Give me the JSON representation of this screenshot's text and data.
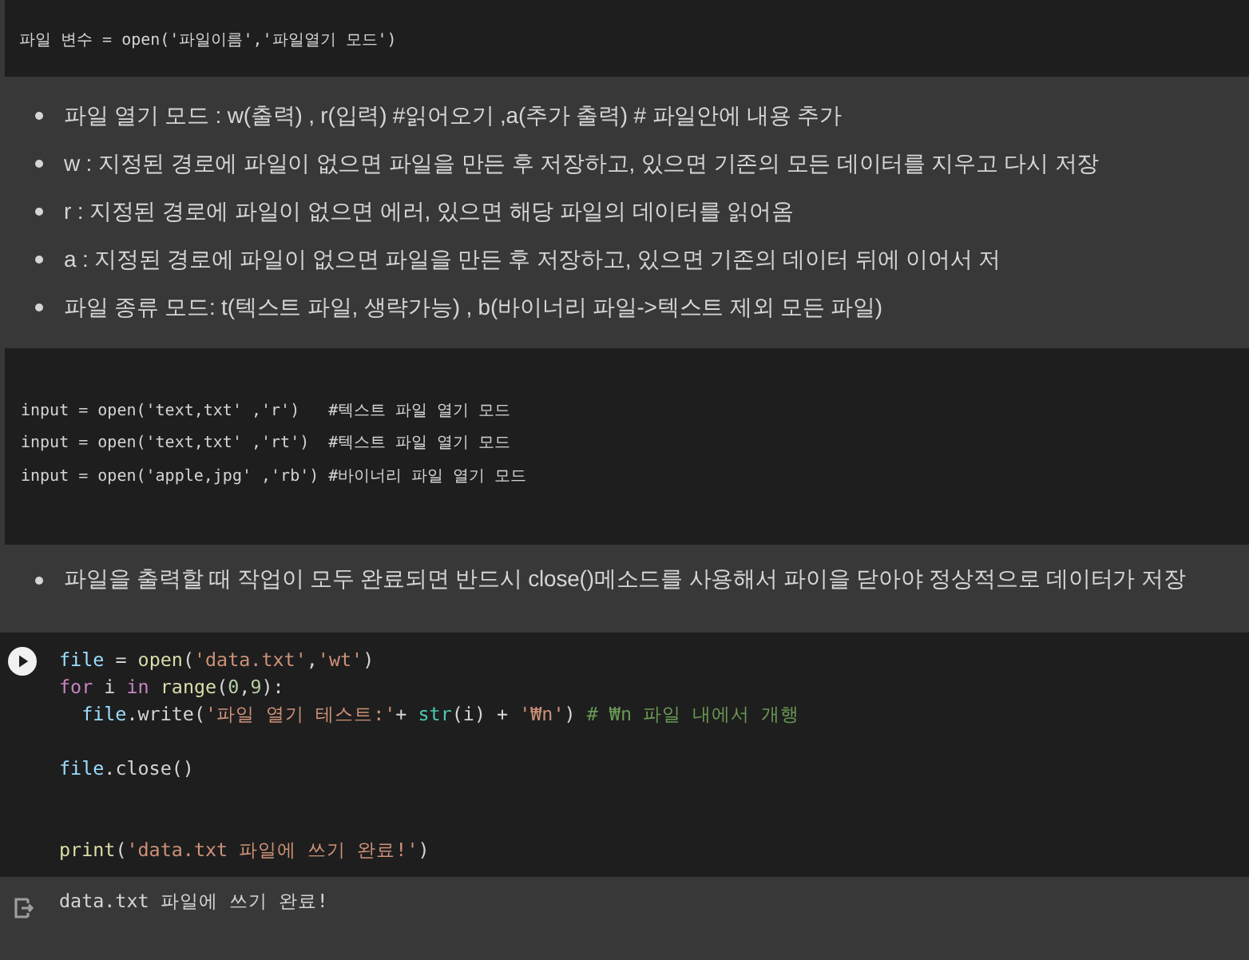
{
  "text_cell": {
    "blocks": [
      {
        "kind": "code_block",
        "lines": [
          "파일 변수 = open('파일이름','파일열기 모드')"
        ]
      },
      {
        "kind": "bullet_list",
        "items": [
          "파일 열기 모드 : w(출력) , r(입력) #읽어오기 ,a(추가 출력) # 파일안에 내용 추가",
          "w : 지정된 경로에 파일이 없으면 파일을 만든 후 저장하고, 있으면 기존의 모든 데이터를 지우고 다시 저장",
          "r : 지정된 경로에 파일이 없으면 에러, 있으면 해당 파일의 데이터를 읽어옴",
          "a : 지정된 경로에 파일이 없으면 파일을 만든 후 저장하고, 있으면 기존의 데이터 뒤에 이어서 저",
          "파일 종류 모드: t(텍스트 파일, 생략가능) , b(바이너리 파일->텍스트 제외 모든 파일)"
        ]
      },
      {
        "kind": "code_block",
        "lines": [
          "input = open('text,txt' ,'r')   #텍스트 파일 열기 모드",
          "input = open('text,txt' ,'rt')  #텍스트 파일 열기 모드",
          "input = open('apple,jpg' ,'rb') #바이너리 파일 열기 모드"
        ]
      },
      {
        "kind": "bullet_list",
        "items": [
          "파일을 출력할 때 작업이 모두 완료되면 반드시 close()메소드를 사용해서 파이을 닫아야 정상적으로 데이터가 저장"
        ]
      }
    ]
  },
  "code_cell": {
    "lines": [
      {
        "kind": "code",
        "tokens": [
          {
            "text": "file",
            "kind": "variable"
          },
          {
            "text": " = ",
            "kind": "plain"
          },
          {
            "text": "open",
            "kind": "function"
          },
          {
            "text": "(",
            "kind": "plain"
          },
          {
            "text": "'data.txt'",
            "kind": "string"
          },
          {
            "text": ",",
            "kind": "plain"
          },
          {
            "text": "'wt'",
            "kind": "string"
          },
          {
            "text": ")",
            "kind": "plain"
          }
        ]
      },
      {
        "kind": "code",
        "tokens": [
          {
            "text": "for",
            "kind": "keyword"
          },
          {
            "text": " i ",
            "kind": "plain"
          },
          {
            "text": "in",
            "kind": "keyword"
          },
          {
            "text": " range",
            "kind": "function"
          },
          {
            "text": "(",
            "kind": "plain"
          },
          {
            "text": "0",
            "kind": "number"
          },
          {
            "text": ",",
            "kind": "plain"
          },
          {
            "text": "9",
            "kind": "number"
          },
          {
            "text": "):",
            "kind": "plain"
          }
        ],
        "children": [
          {
            "kind": "code",
            "tokens": [
              {
                "text": "file",
                "kind": "variable"
              },
              {
                "text": ".write(",
                "kind": "plain"
              },
              {
                "text": "'파일 열기 테스트:'",
                "kind": "string"
              },
              {
                "text": "+ ",
                "kind": "plain"
              },
              {
                "text": "str",
                "kind": "builtin"
              },
              {
                "text": "(i) + ",
                "kind": "plain"
              },
              {
                "text": "'₩n'",
                "kind": "string"
              },
              {
                "text": ") ",
                "kind": "plain"
              },
              {
                "text": "# ₩n 파일 내에서 개행",
                "kind": "comment"
              }
            ]
          }
        ]
      },
      {
        "kind": "blank"
      },
      {
        "kind": "code",
        "tokens": [
          {
            "text": "file",
            "kind": "variable"
          },
          {
            "text": ".close()",
            "kind": "plain"
          }
        ]
      },
      {
        "kind": "blank"
      },
      {
        "kind": "blank"
      },
      {
        "kind": "code",
        "tokens": [
          {
            "text": "print",
            "kind": "function"
          },
          {
            "text": "(",
            "kind": "plain"
          },
          {
            "text": "'data.txt 파일에 쓰기 완료!'",
            "kind": "string"
          },
          {
            "text": ")",
            "kind": "plain"
          }
        ]
      }
    ],
    "output": {
      "lines": [
        "data.txt 파일에 쓰기 완료!"
      ]
    }
  }
}
